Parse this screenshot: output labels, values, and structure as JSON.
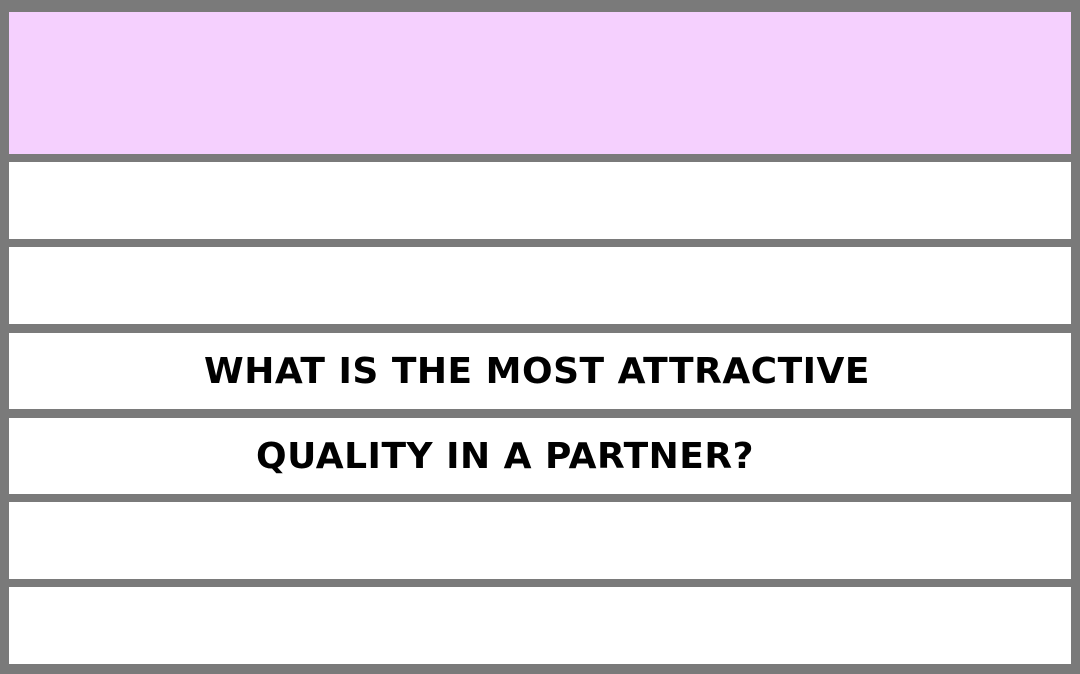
{
  "question": {
    "line1": "WHAT IS THE MOST ATTRACTIVE",
    "line2": "QUALITY IN A PARTNER?"
  },
  "colors": {
    "header_band": "#f5d0fe",
    "frame": "#7a7a7a",
    "row_background": "#ffffff",
    "text": "#000000"
  }
}
